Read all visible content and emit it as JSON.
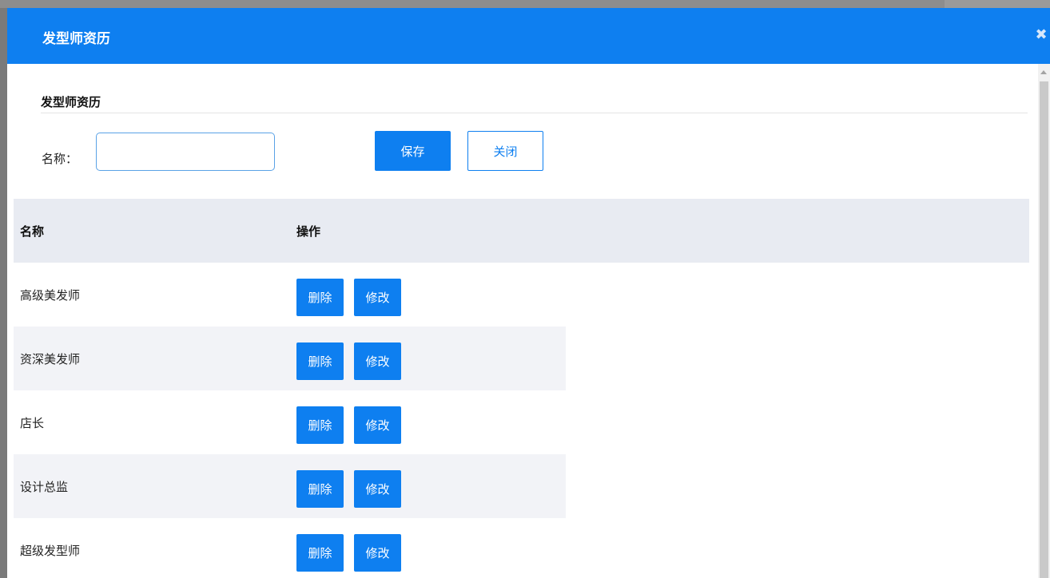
{
  "dialog": {
    "title": "发型师资历",
    "close_icon": "close-icon"
  },
  "section": {
    "title": "发型师资历"
  },
  "form": {
    "name_label": "名称：",
    "name_value": "",
    "name_placeholder": "",
    "save_label": "保存",
    "close_label": "关闭"
  },
  "table": {
    "columns": [
      "名称",
      "操作"
    ],
    "rows": [
      {
        "name": "高级美发师",
        "delete_label": "删除",
        "edit_label": "修改"
      },
      {
        "name": "资深美发师",
        "delete_label": "删除",
        "edit_label": "修改"
      },
      {
        "name": "店长",
        "delete_label": "删除",
        "edit_label": "修改"
      },
      {
        "name": "设计总监",
        "delete_label": "删除",
        "edit_label": "修改"
      },
      {
        "name": "超级发型师",
        "delete_label": "删除",
        "edit_label": "修改"
      }
    ]
  },
  "colors": {
    "accent": "#0e7ff0",
    "header_bg": "#e8ebf2",
    "row_alt_bg": "#f2f3f7"
  }
}
